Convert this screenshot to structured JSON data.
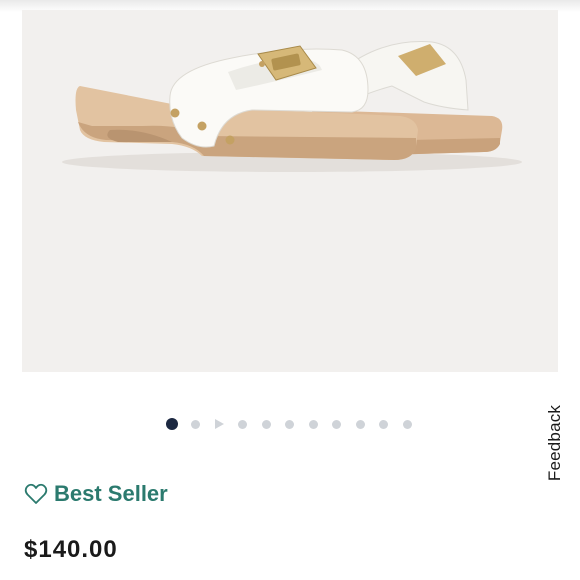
{
  "product": {
    "image_alt": "White leather slide sandal with wooden sole and gold buckle",
    "badge_label": "Best Seller",
    "price": "$140.00"
  },
  "carousel": {
    "slide_count": 11,
    "active_index": 0,
    "has_video_slide": true
  },
  "feedback": {
    "label": "Feedback"
  },
  "colors": {
    "accent_green": "#2b7a6e",
    "dot_active": "#1c2841",
    "dot_inactive": "#cfd3d8",
    "hero_bg": "#f2f0ee"
  },
  "icons": {
    "favorite": "heart-outline-icon",
    "video": "play-icon"
  }
}
